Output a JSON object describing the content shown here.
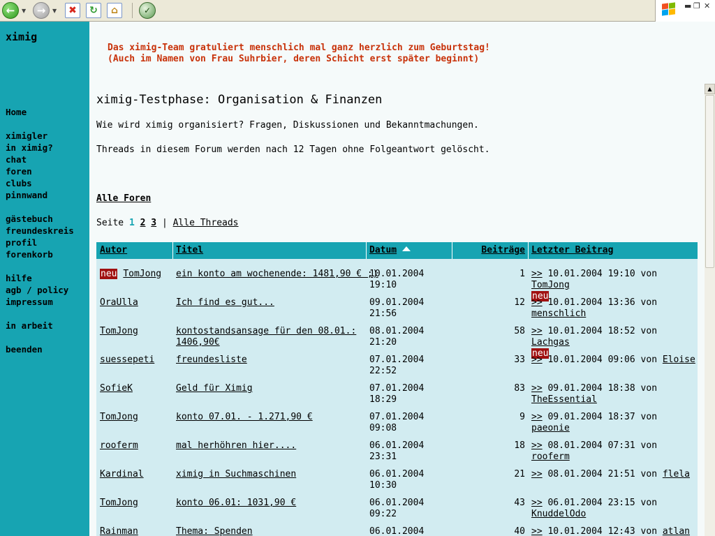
{
  "browser": {
    "back_icon": "back-arrow-icon",
    "forward_icon": "forward-arrow-icon",
    "stop_icon": "stop-x-icon",
    "refresh_icon": "refresh-icon",
    "home_icon": "home-icon",
    "media_icon": "media-icon",
    "brand_colors": [
      "#f25022",
      "#7fba00",
      "#00a4ef",
      "#ffb900"
    ]
  },
  "sidebar": {
    "brand": "ximig",
    "groups": [
      [
        "Home"
      ],
      [
        "ximigler",
        "in ximig?",
        "chat",
        "foren",
        "clubs",
        "pinnwand"
      ],
      [
        "gästebuch",
        "freundeskreis",
        "profil",
        "forenkorb"
      ],
      [
        "hilfe",
        "agb / policy",
        "impressum"
      ],
      [
        "in arbeit"
      ],
      [
        "beenden"
      ]
    ]
  },
  "greeting": {
    "line1": "Das ximig-Team gratuliert menschlich mal ganz herzlich zum Geburtstag!",
    "line2": "(Auch im Namen von Frau Suhrbier, deren Schicht erst später beginnt)"
  },
  "page": {
    "title": "ximig-Testphase: Organisation & Finanzen",
    "description": "Wie wird ximig organisiert? Fragen, Diskussionen und Bekanntmachungen.",
    "note": "Threads in diesem Forum werden nach 12 Tagen ohne Folgeantwort gelöscht.",
    "all_forums": "Alle Foren"
  },
  "pager": {
    "label": "Seite",
    "pages": [
      "1",
      "2",
      "3"
    ],
    "current": "1",
    "separator": "|",
    "all_threads": "Alle Threads"
  },
  "table": {
    "headers": {
      "author": "Autor",
      "title": "Titel",
      "date": "Datum",
      "posts": "Beiträge",
      "last": "Letzter Beitrag"
    },
    "new_badge": "neu",
    "last_link": ">>",
    "by": "von",
    "rows": [
      {
        "new": true,
        "author": "TomJong",
        "title_lines": [
          "ein konto am wochenende: 1481,90 € ;)"
        ],
        "date": "10.01.2004",
        "time": "19:10",
        "posts": "1",
        "last_date": "10.01.2004 19:10",
        "last_user": "TomJong",
        "last_wrap": false,
        "last_new": true
      },
      {
        "new": false,
        "author": "OraUlla",
        "title_lines": [
          "Ich find es gut..."
        ],
        "date": "09.01.2004",
        "time": "21:56",
        "posts": "12",
        "last_date": "10.01.2004 13:36",
        "last_user": "menschlich",
        "last_wrap": true,
        "last_new": false
      },
      {
        "new": false,
        "author": "TomJong",
        "title_lines": [
          "kontostandsansage für den 08.01.:",
          "1406,90€"
        ],
        "date": "08.01.2004",
        "time": "21:20",
        "posts": "58",
        "last_date": "10.01.2004 18:52",
        "last_user": "Lachgas",
        "last_wrap": false,
        "last_new": true
      },
      {
        "new": false,
        "author": "suessepeti",
        "title_lines": [
          "freundesliste"
        ],
        "date": "07.01.2004",
        "time": "22:52",
        "posts": "33",
        "last_date": "10.01.2004 09:06",
        "last_user": "Eloise",
        "last_wrap": false,
        "last_new": false
      },
      {
        "new": false,
        "author": "SofieK",
        "title_lines": [
          "Geld für Ximig"
        ],
        "date": "07.01.2004",
        "time": "18:29",
        "posts": "83",
        "last_date": "09.01.2004 18:38",
        "last_user": "TheEssential",
        "last_wrap": true,
        "last_new": false
      },
      {
        "new": false,
        "author": "TomJong",
        "title_lines": [
          "konto 07.01. - 1.271,90 €"
        ],
        "date": "07.01.2004",
        "time": "09:08",
        "posts": "9",
        "last_date": "09.01.2004 18:37",
        "last_user": "paeonie",
        "last_wrap": false,
        "last_new": false
      },
      {
        "new": false,
        "author": "rooferm",
        "title_lines": [
          "mal herhöhren hier...."
        ],
        "date": "06.01.2004",
        "time": "23:31",
        "posts": "18",
        "last_date": "08.01.2004 07:31",
        "last_user": "rooferm",
        "last_wrap": false,
        "last_new": false
      },
      {
        "new": false,
        "author": "Kardinal",
        "title_lines": [
          "ximig in Suchmaschinen"
        ],
        "date": "06.01.2004",
        "time": "10:30",
        "posts": "21",
        "last_date": "08.01.2004 21:51",
        "last_user": "flela",
        "last_wrap": false,
        "last_new": false
      },
      {
        "new": false,
        "author": "TomJong",
        "title_lines": [
          "konto 06.01: 1031,90 €"
        ],
        "date": "06.01.2004",
        "time": "09:22",
        "posts": "43",
        "last_date": "06.01.2004 23:15",
        "last_user": "KnuddelOdo",
        "last_wrap": true,
        "last_new": false
      },
      {
        "new": false,
        "author": "Rainman",
        "title_lines": [
          "Thema: Spenden"
        ],
        "date": "06.01.2004",
        "time": "",
        "posts": "40",
        "last_date": "10.01.2004 12:43",
        "last_user": "atlan",
        "last_wrap": false,
        "last_new": false
      }
    ]
  }
}
